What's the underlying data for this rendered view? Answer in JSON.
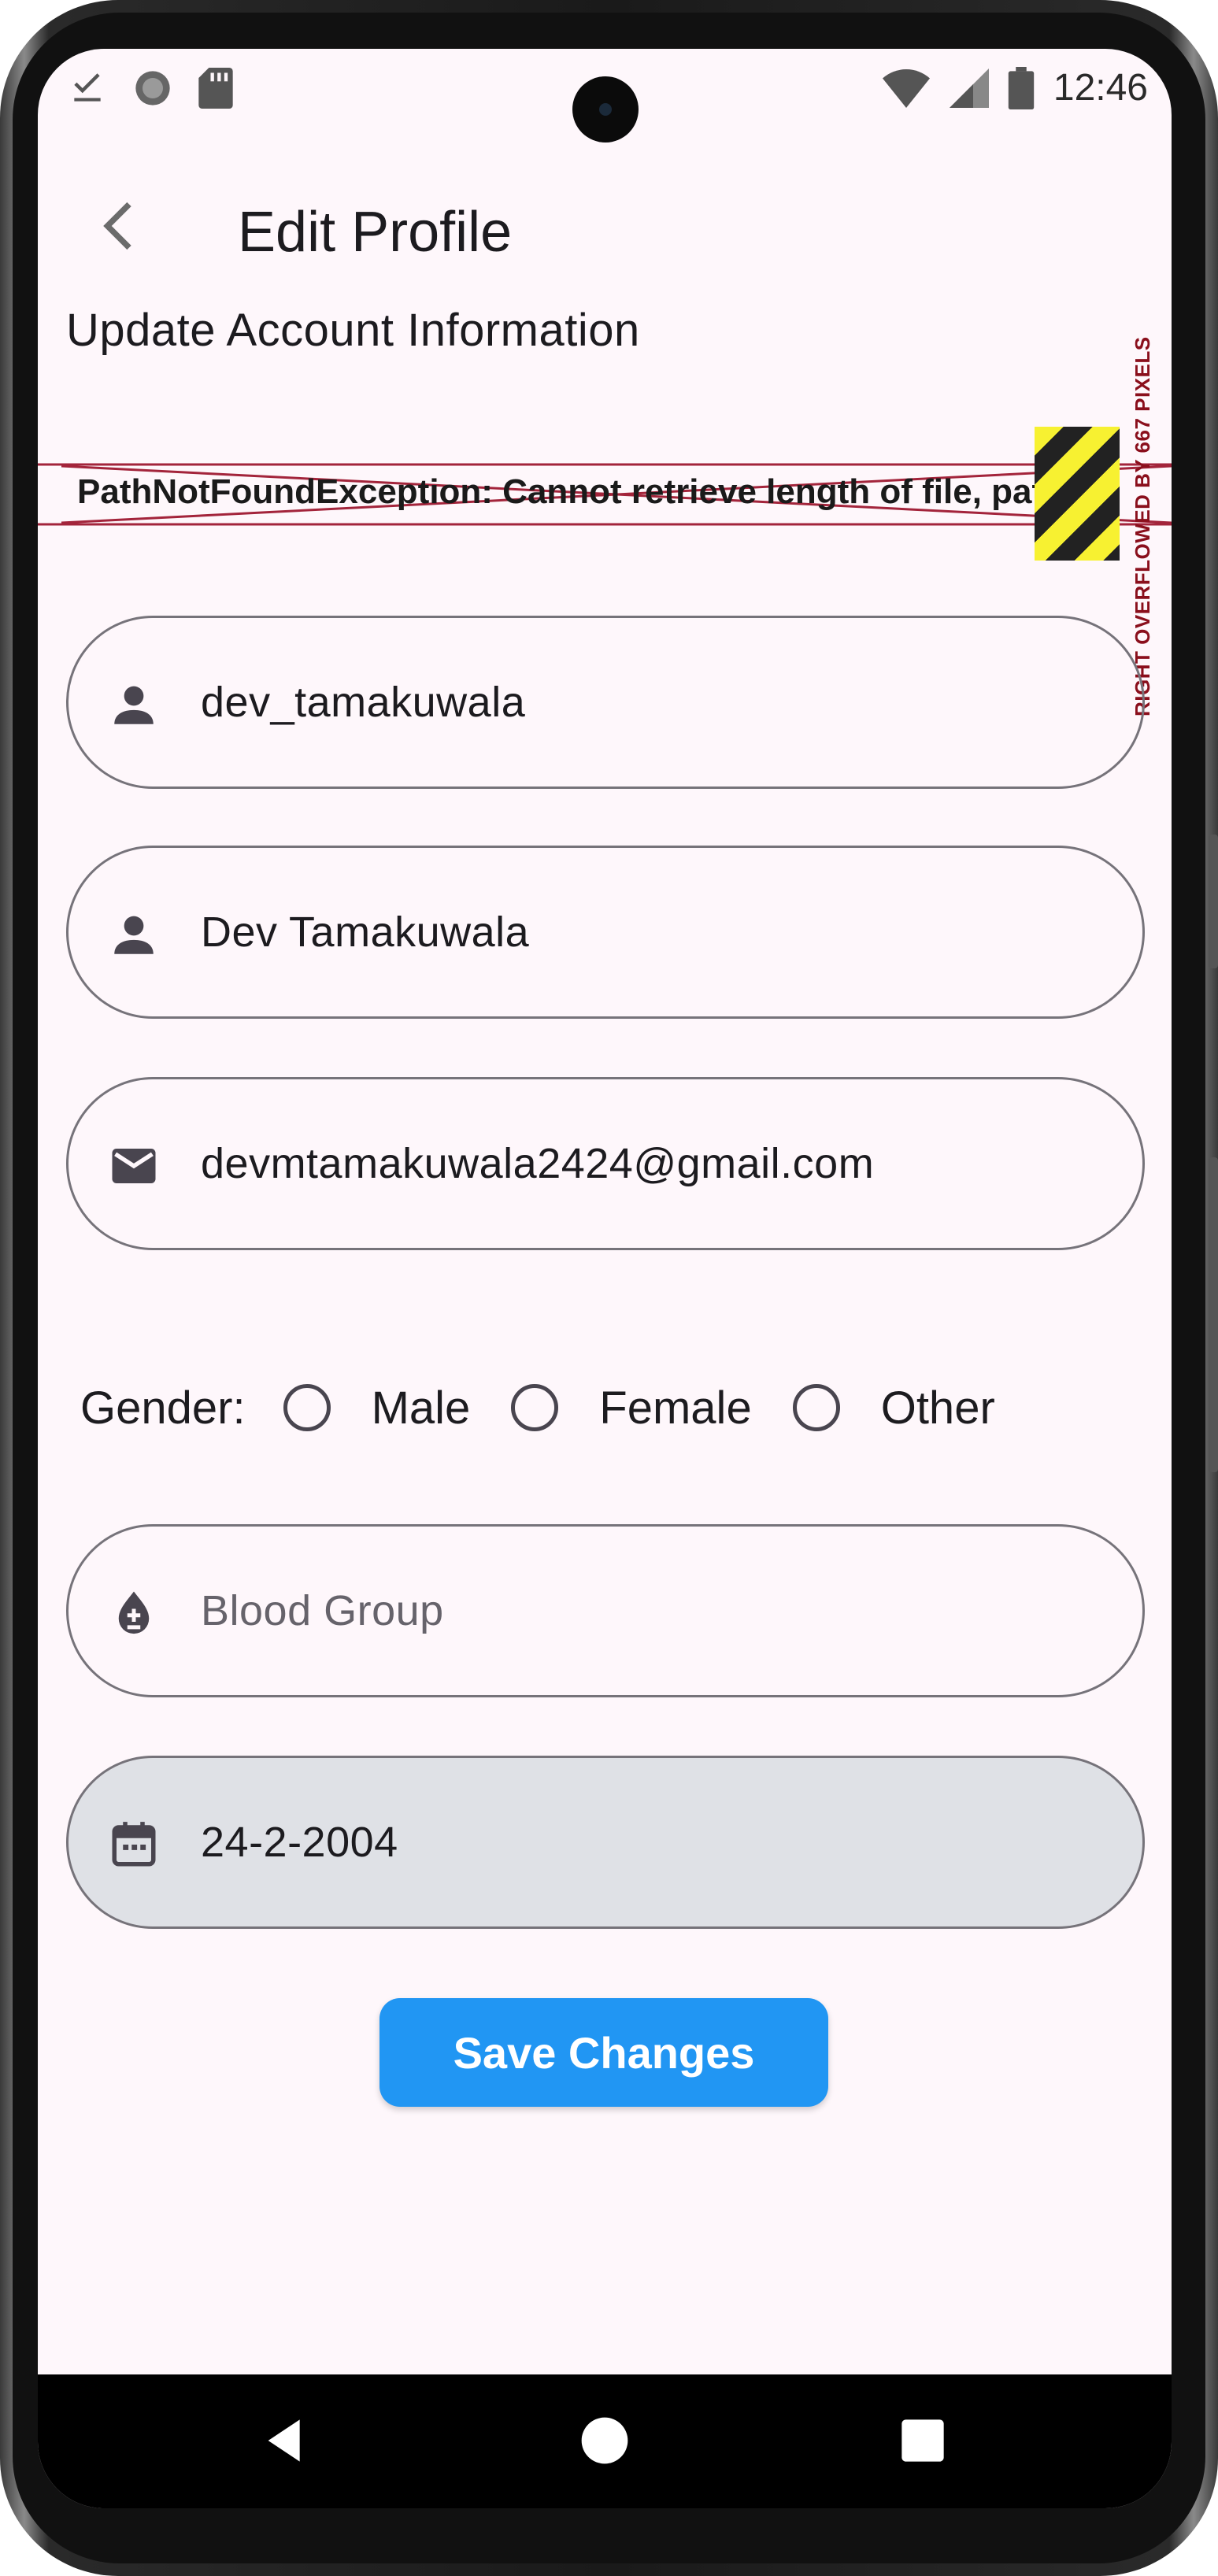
{
  "status_bar": {
    "time": "12:46",
    "left_icons": [
      "download-done-icon",
      "circle-status-icon",
      "sd-card-icon"
    ],
    "right_icons": [
      "wifi-icon",
      "cell-signal-icon",
      "battery-icon"
    ]
  },
  "app_bar": {
    "title": "Edit Profile",
    "back_icon": "chevron-left-icon"
  },
  "section_title": "Update Account Information",
  "error_overlay": {
    "message": "PathNotFoundException: Cannot retrieve length of file, path = ''",
    "overflow_label": "RIGHT OVERFLOWED BY 667 PIXELS"
  },
  "form": {
    "username": {
      "value": "dev_tamakuwala",
      "icon": "person-icon"
    },
    "full_name": {
      "value": "Dev Tamakuwala",
      "icon": "person-icon"
    },
    "email": {
      "value": "devmtamakuwala2424@gmail.com",
      "icon": "mail-icon"
    },
    "gender": {
      "label": "Gender:",
      "options": [
        "Male",
        "Female",
        "Other"
      ],
      "selected": null
    },
    "blood_group": {
      "placeholder": "Blood Group",
      "value": "",
      "icon": "blood-drop-icon"
    },
    "dob": {
      "value": "24-2-2004",
      "icon": "calendar-icon"
    }
  },
  "save_button": {
    "label": "Save Changes"
  },
  "colors": {
    "background": "#fef7fb",
    "primary_button": "#2196f3",
    "field_border": "#76737a",
    "filled_field": "#dfe1e6",
    "error_red": "#8a0f1c",
    "hazard_yellow": "#f7f131"
  }
}
